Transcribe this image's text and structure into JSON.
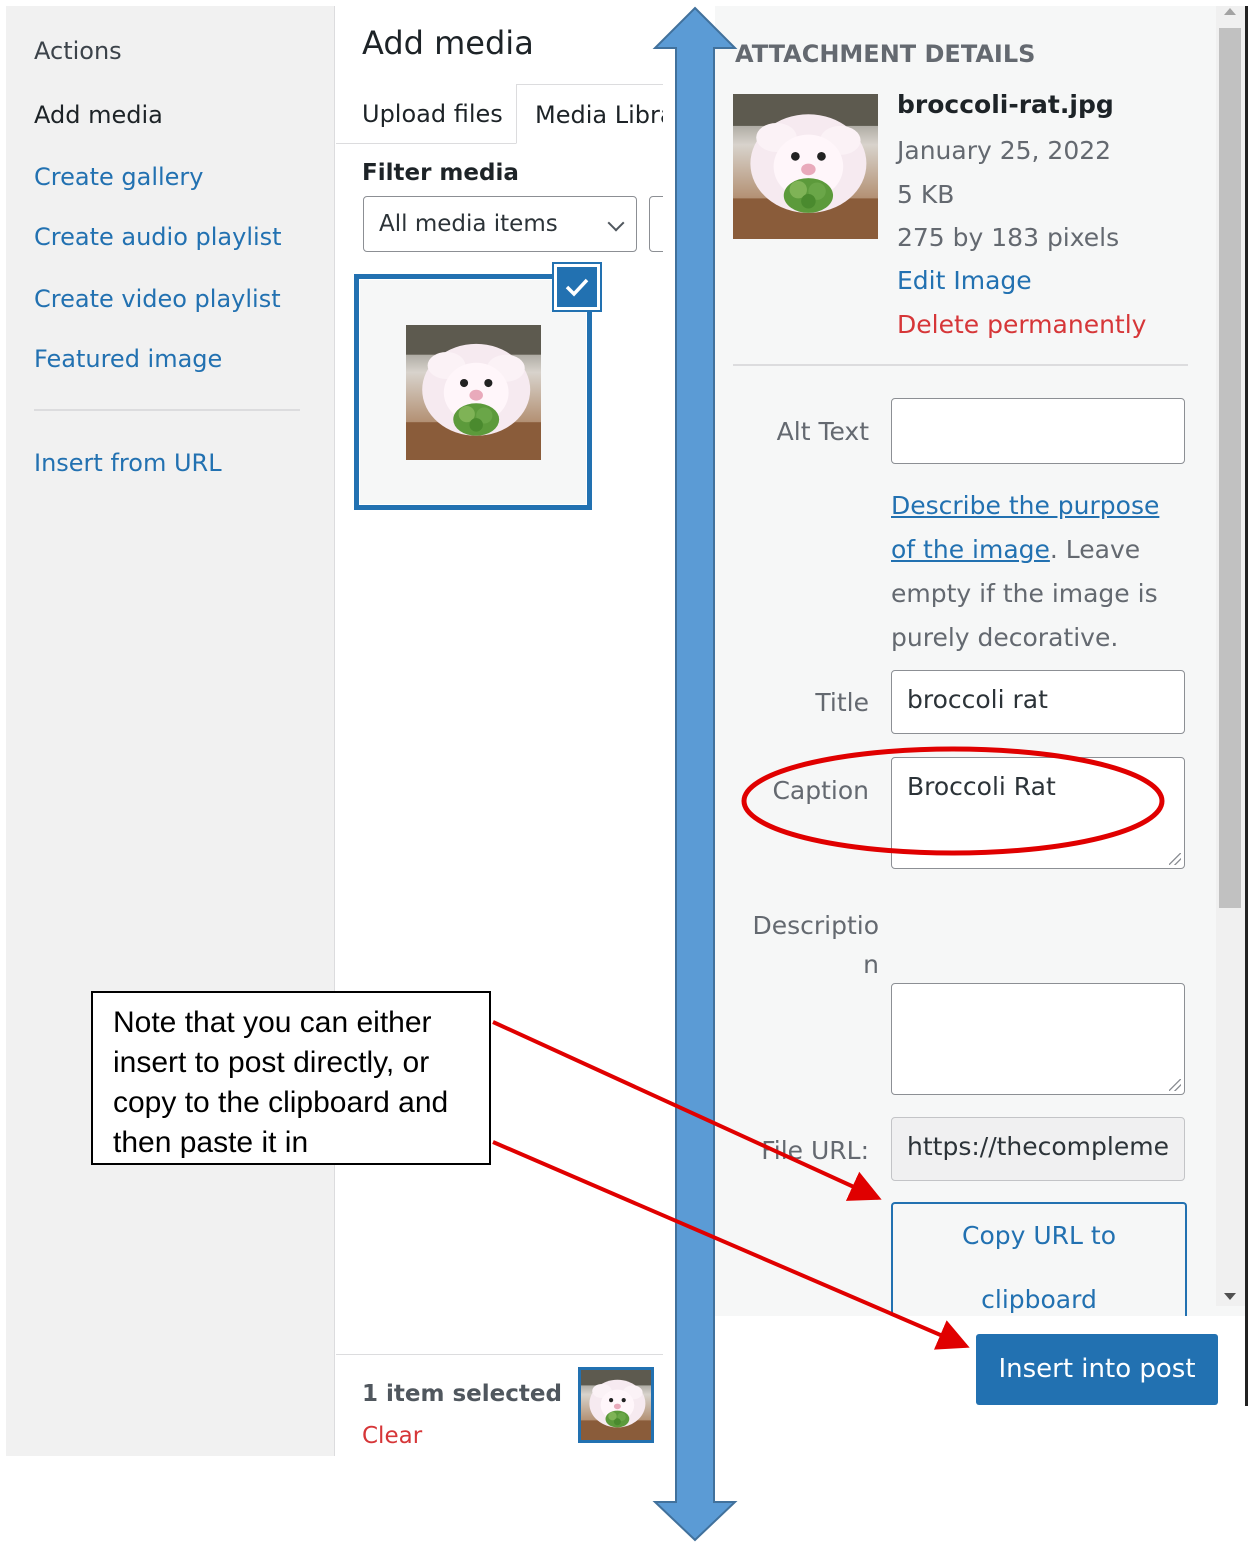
{
  "sidebar": {
    "heading": "Actions",
    "items": [
      {
        "label": "Add media"
      },
      {
        "label": "Create gallery"
      },
      {
        "label": "Create audio playlist"
      },
      {
        "label": "Create video playlist"
      },
      {
        "label": "Featured image"
      },
      {
        "label": "Insert from URL"
      }
    ]
  },
  "content": {
    "title": "Add media",
    "tabs": [
      {
        "label": "Upload files"
      },
      {
        "label": "Media Libra"
      }
    ],
    "filter_label": "Filter media",
    "filter_value": "All media items"
  },
  "selection": {
    "count_text": "1 item selected",
    "clear_label": "Clear"
  },
  "details": {
    "heading": "ATTACHMENT DETAILS",
    "filename": "broccoli-rat.jpg",
    "date": "January 25, 2022",
    "size": "5 KB",
    "dimensions": "275 by 183 pixels",
    "edit_label": "Edit Image",
    "delete_label": "Delete permanently",
    "alt_text": {
      "label": "Alt Text",
      "value": ""
    },
    "alt_help_link": "Describe the purpose of the image",
    "alt_help_rest": ". Leave empty if the image is purely decorative.",
    "title": {
      "label": "Title",
      "value": "broccoli rat"
    },
    "caption": {
      "label": "Caption",
      "value": "Broccoli Rat"
    },
    "description": {
      "label_line1": "Descriptio",
      "label_line2": "n",
      "value": ""
    },
    "file_url": {
      "label": "File URL:",
      "value": "https://thecompleme"
    },
    "copy_label_line1": "Copy URL to",
    "copy_label_line2": "clipboard"
  },
  "insert_label": "Insert into post",
  "annotation": {
    "note_lines": [
      "Note that you can either",
      "insert to post directly, or",
      "copy to the clipboard and",
      "then paste it in"
    ]
  },
  "colors": {
    "wp_blue": "#2271b1",
    "delete_red": "#d63638",
    "annotation_red": "#e00000",
    "annotation_arrow_blue": "#5b9bd5"
  },
  "icons": {
    "check": "check-icon",
    "select": "chevron-down-icon",
    "resize": "resize-grip-icon"
  }
}
